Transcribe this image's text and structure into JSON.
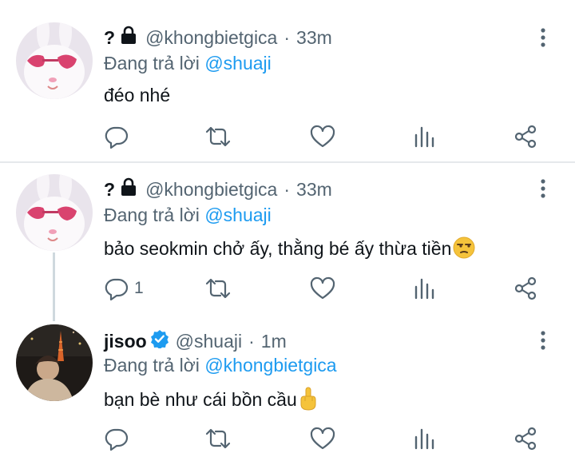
{
  "tweets": [
    {
      "name": "?",
      "handle": "@khongbietgica",
      "separator": "·",
      "time": "33m",
      "reply_prefix": "Đang trả lời ",
      "reply_to": "@shuaji",
      "text": "đéo nhé",
      "reply_count": "",
      "avatar": "white-bunny-heart-glasses",
      "locked": true,
      "verified": false
    },
    {
      "name": "?",
      "handle": "@khongbietgica",
      "separator": "·",
      "time": "33m",
      "reply_prefix": "Đang trả lời ",
      "reply_to": "@shuaji",
      "text": "bảo seokmin chở ấy, thằng bé ấy thừa tiền",
      "emoji": "unamused-face",
      "reply_count": "1",
      "avatar": "white-bunny-heart-glasses",
      "locked": true,
      "verified": false
    },
    {
      "name": "jisoo",
      "handle": "@shuaji",
      "separator": "·",
      "time": "1m",
      "reply_prefix": "Đang trả lời ",
      "reply_to": "@khongbietgica",
      "text": "bạn bè như cái bồn cầu",
      "emoji": "middle-finger",
      "reply_count": "",
      "avatar": "person-night-tokyo-tower",
      "locked": false,
      "verified": true
    }
  ],
  "colors": {
    "link": "#1d9bf0",
    "secondary_text": "#536471",
    "verified_badge": "#1d9bf0"
  },
  "icons": [
    "reply-icon",
    "retweet-icon",
    "like-icon",
    "views-icon",
    "share-icon",
    "more-icon",
    "lock-icon",
    "verified-icon"
  ]
}
